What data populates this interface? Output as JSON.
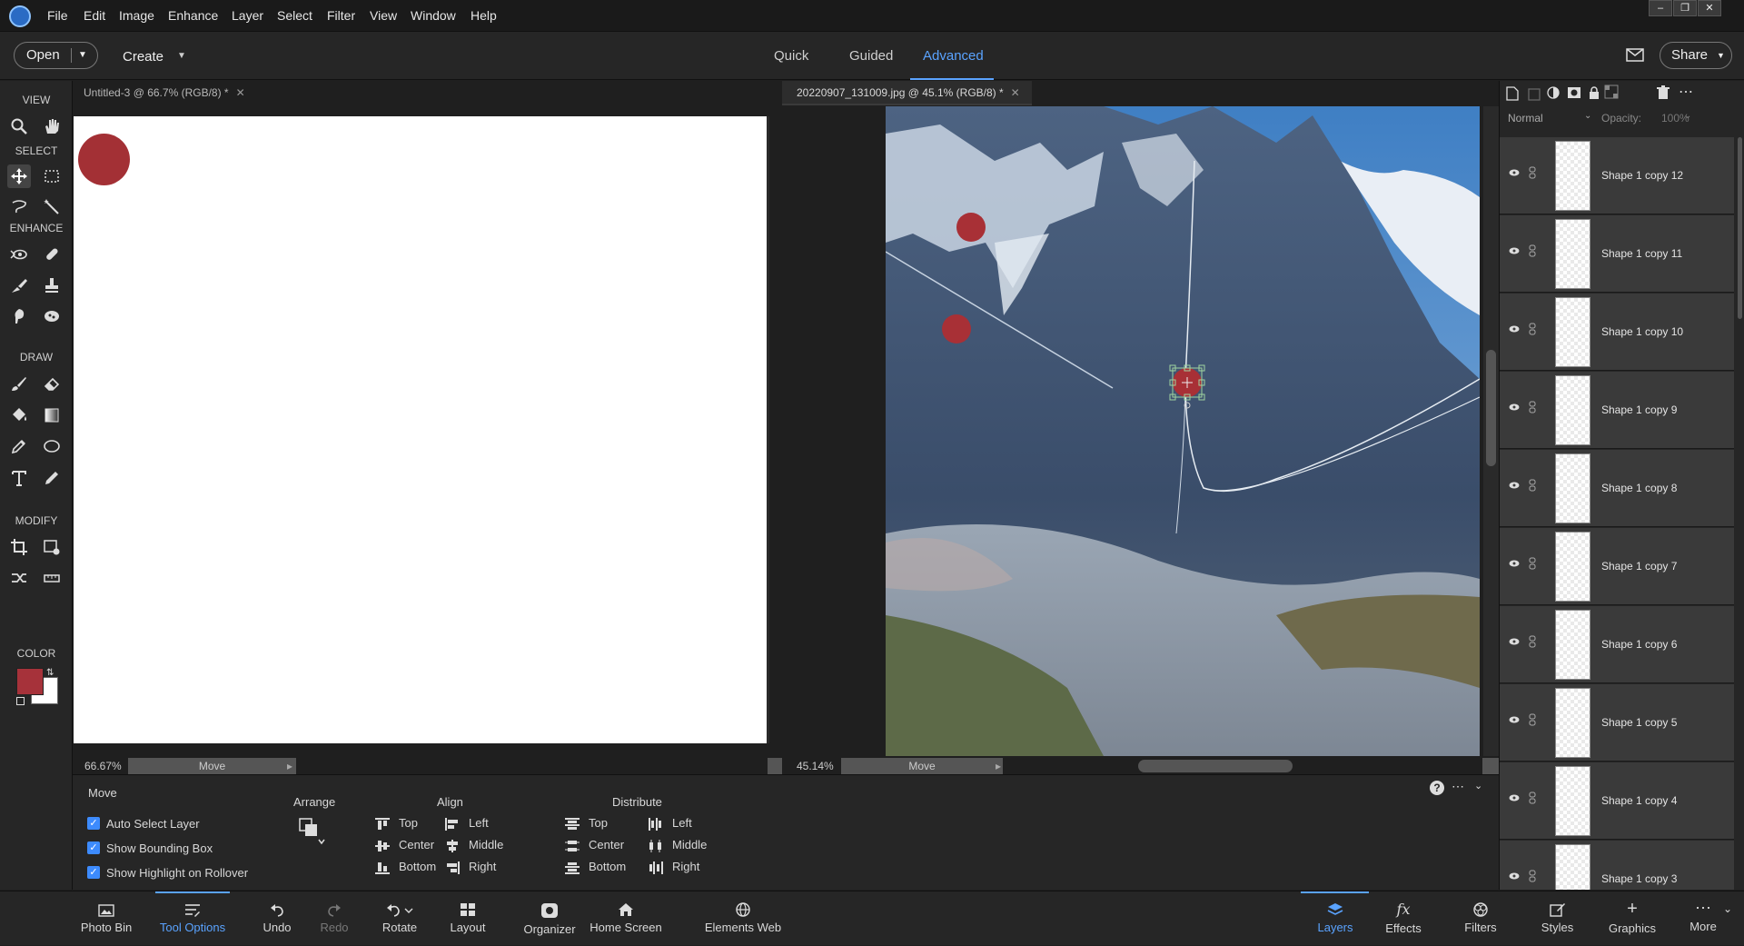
{
  "menubar": {
    "items": [
      "File",
      "Edit",
      "Image",
      "Enhance",
      "Layer",
      "Select",
      "Filter",
      "View",
      "Window",
      "Help"
    ]
  },
  "modebar": {
    "open_label": "Open",
    "create_label": "Create",
    "tabs": [
      "Quick",
      "Guided",
      "Advanced"
    ],
    "active_tab": "Advanced",
    "share_label": "Share"
  },
  "toolbar": {
    "sections": [
      "VIEW",
      "SELECT",
      "ENHANCE",
      "DRAW",
      "MODIFY",
      "COLOR"
    ],
    "foreground_color": "#a6323a",
    "background_color": "#ffffff"
  },
  "doc1": {
    "tab_title": "Untitled-3 @ 66.7% (RGB/8) *",
    "zoom": "66.67%",
    "status_tool": "Move",
    "shape_color": "#a33035"
  },
  "doc2": {
    "tab_title": "20220907_131009.jpg @ 45.1% (RGB/8) *",
    "zoom": "45.14%",
    "status_tool": "Move",
    "shape_color": "#a83036"
  },
  "tooloptions": {
    "tool_name": "Move",
    "checkboxes": [
      "Auto Select Layer",
      "Show Bounding Box",
      "Show Highlight on Rollover"
    ],
    "arrange_label": "Arrange",
    "align_label": "Align",
    "distribute_label": "Distribute",
    "align_col1": [
      "Top",
      "Center",
      "Bottom"
    ],
    "align_col2": [
      "Left",
      "Middle",
      "Right"
    ],
    "distribute_col1": [
      "Top",
      "Center",
      "Bottom"
    ],
    "distribute_col2": [
      "Left",
      "Middle",
      "Right"
    ]
  },
  "layers": {
    "blend_mode": "Normal",
    "opacity_label": "Opacity:",
    "opacity_value": "100%",
    "items": [
      "Shape 1 copy 12",
      "Shape 1 copy 11",
      "Shape 1 copy 10",
      "Shape 1 copy 9",
      "Shape 1 copy 8",
      "Shape 1 copy 7",
      "Shape 1 copy 6",
      "Shape 1 copy 5",
      "Shape 1 copy 4",
      "Shape 1 copy 3"
    ]
  },
  "taskbar": {
    "left": [
      "Photo Bin",
      "Tool Options",
      "Undo",
      "Redo",
      "Rotate",
      "Layout",
      "Organizer",
      "Home Screen",
      "Elements Web"
    ],
    "right": [
      "Layers",
      "Effects",
      "Filters",
      "Styles",
      "Graphics",
      "More"
    ],
    "active_left": "Tool Options",
    "active_right": "Layers"
  },
  "colors": {
    "accent": "#5aa3ff",
    "panel": "#262626"
  }
}
